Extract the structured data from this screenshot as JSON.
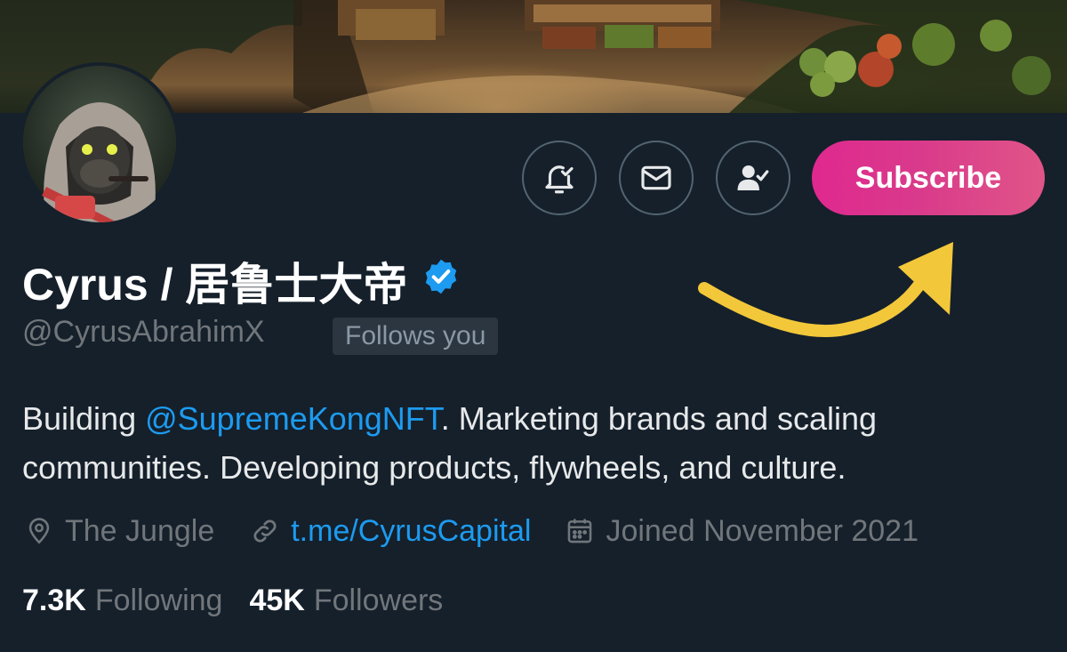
{
  "profile": {
    "display_name": "Cyrus / 居鲁士大帝",
    "handle": "@CyrusAbrahimX",
    "follows_you": "Follows you",
    "bio_prefix": "Building ",
    "bio_mention": "@SupremeKongNFT",
    "bio_suffix": ". Marketing brands and scaling communities. Developing products, flywheels, and culture.",
    "location": "The Jungle",
    "website": "t.me/CyrusCapital",
    "joined": "Joined November 2021",
    "following_count": "7.3K",
    "following_label": "Following",
    "followers_count": "45K",
    "followers_label": "Followers"
  },
  "actions": {
    "notify_icon": "bell-check-icon",
    "message_icon": "mail-icon",
    "following_icon": "person-check-icon",
    "subscribe_label": "Subscribe"
  },
  "colors": {
    "background": "#15202b",
    "accent_link": "#1d9bf0",
    "subscribe_gradient_start": "#e0288f",
    "subscribe_gradient_end": "#e05588",
    "annotation_arrow": "#f2c73a",
    "verified_badge": "#1d9bf0"
  }
}
